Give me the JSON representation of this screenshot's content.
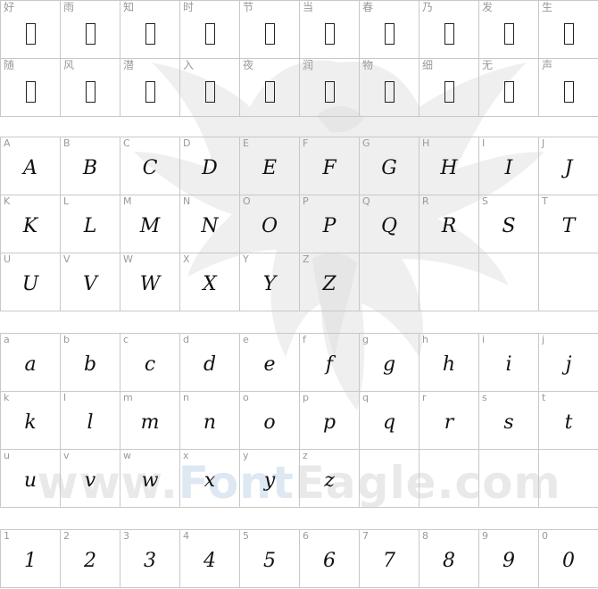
{
  "watermark": {
    "text_a": "www.",
    "text_b": "Font",
    "text_c": "Eagle.com"
  },
  "sections": [
    {
      "id": "chinese",
      "cjk": true,
      "cells": [
        {
          "label": "好"
        },
        {
          "label": "雨"
        },
        {
          "label": "知"
        },
        {
          "label": "时"
        },
        {
          "label": "节"
        },
        {
          "label": "当"
        },
        {
          "label": "春"
        },
        {
          "label": "乃"
        },
        {
          "label": "发"
        },
        {
          "label": "生"
        },
        {
          "label": "随"
        },
        {
          "label": "风"
        },
        {
          "label": "潜"
        },
        {
          "label": "入"
        },
        {
          "label": "夜"
        },
        {
          "label": "润"
        },
        {
          "label": "物"
        },
        {
          "label": "细"
        },
        {
          "label": "无"
        },
        {
          "label": "声"
        }
      ]
    },
    {
      "id": "uppercase",
      "cjk": false,
      "cells": [
        {
          "label": "A",
          "glyph": "A"
        },
        {
          "label": "B",
          "glyph": "B"
        },
        {
          "label": "C",
          "glyph": "C"
        },
        {
          "label": "D",
          "glyph": "D"
        },
        {
          "label": "E",
          "glyph": "E"
        },
        {
          "label": "F",
          "glyph": "F"
        },
        {
          "label": "G",
          "glyph": "G"
        },
        {
          "label": "H",
          "glyph": "H"
        },
        {
          "label": "I",
          "glyph": "I"
        },
        {
          "label": "J",
          "glyph": "J"
        },
        {
          "label": "K",
          "glyph": "K"
        },
        {
          "label": "L",
          "glyph": "L"
        },
        {
          "label": "M",
          "glyph": "M"
        },
        {
          "label": "N",
          "glyph": "N"
        },
        {
          "label": "O",
          "glyph": "O"
        },
        {
          "label": "P",
          "glyph": "P"
        },
        {
          "label": "Q",
          "glyph": "Q"
        },
        {
          "label": "R",
          "glyph": "R"
        },
        {
          "label": "S",
          "glyph": "S"
        },
        {
          "label": "T",
          "glyph": "T"
        },
        {
          "label": "U",
          "glyph": "U"
        },
        {
          "label": "V",
          "glyph": "V"
        },
        {
          "label": "W",
          "glyph": "W"
        },
        {
          "label": "X",
          "glyph": "X"
        },
        {
          "label": "Y",
          "glyph": "Y"
        },
        {
          "label": "Z",
          "glyph": "Z"
        },
        {
          "label": "",
          "glyph": ""
        },
        {
          "label": "",
          "glyph": ""
        },
        {
          "label": "",
          "glyph": ""
        },
        {
          "label": "",
          "glyph": ""
        }
      ]
    },
    {
      "id": "lowercase",
      "cjk": false,
      "cells": [
        {
          "label": "a",
          "glyph": "a"
        },
        {
          "label": "b",
          "glyph": "b"
        },
        {
          "label": "c",
          "glyph": "c"
        },
        {
          "label": "d",
          "glyph": "d"
        },
        {
          "label": "e",
          "glyph": "e"
        },
        {
          "label": "f",
          "glyph": "f"
        },
        {
          "label": "g",
          "glyph": "g"
        },
        {
          "label": "h",
          "glyph": "h"
        },
        {
          "label": "i",
          "glyph": "i"
        },
        {
          "label": "j",
          "glyph": "j"
        },
        {
          "label": "k",
          "glyph": "k"
        },
        {
          "label": "l",
          "glyph": "l"
        },
        {
          "label": "m",
          "glyph": "m"
        },
        {
          "label": "n",
          "glyph": "n"
        },
        {
          "label": "o",
          "glyph": "o"
        },
        {
          "label": "p",
          "glyph": "p"
        },
        {
          "label": "q",
          "glyph": "q"
        },
        {
          "label": "r",
          "glyph": "r"
        },
        {
          "label": "s",
          "glyph": "s"
        },
        {
          "label": "t",
          "glyph": "t"
        },
        {
          "label": "u",
          "glyph": "u"
        },
        {
          "label": "v",
          "glyph": "v"
        },
        {
          "label": "w",
          "glyph": "w"
        },
        {
          "label": "x",
          "glyph": "x"
        },
        {
          "label": "y",
          "glyph": "y"
        },
        {
          "label": "z",
          "glyph": "z"
        },
        {
          "label": "",
          "glyph": ""
        },
        {
          "label": "",
          "glyph": ""
        },
        {
          "label": "",
          "glyph": ""
        },
        {
          "label": "",
          "glyph": ""
        }
      ]
    },
    {
      "id": "digits",
      "cjk": false,
      "cells": [
        {
          "label": "1",
          "glyph": "1"
        },
        {
          "label": "2",
          "glyph": "2"
        },
        {
          "label": "3",
          "glyph": "3"
        },
        {
          "label": "4",
          "glyph": "4"
        },
        {
          "label": "5",
          "glyph": "5"
        },
        {
          "label": "6",
          "glyph": "6"
        },
        {
          "label": "7",
          "glyph": "7"
        },
        {
          "label": "8",
          "glyph": "8"
        },
        {
          "label": "9",
          "glyph": "9"
        },
        {
          "label": "0",
          "glyph": "0"
        }
      ]
    }
  ]
}
